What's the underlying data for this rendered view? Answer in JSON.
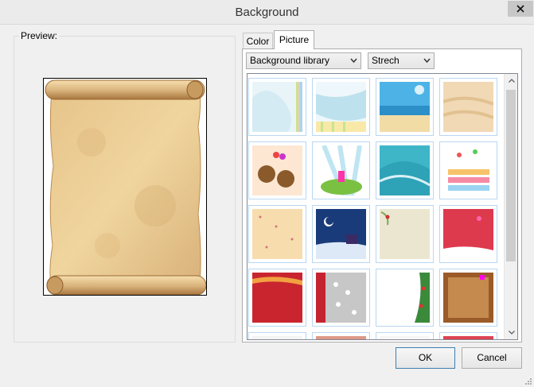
{
  "window": {
    "title": "Background",
    "close_icon": "close-icon"
  },
  "preview": {
    "legend": "Preview:"
  },
  "tabs": [
    {
      "label": "Color",
      "selected": false
    },
    {
      "label": "Picture",
      "selected": true
    }
  ],
  "controls": {
    "library_select": {
      "value": "Background library",
      "icon": "chevron-down-icon"
    },
    "stretch_select": {
      "value": "Strech",
      "icon": "chevron-down-icon"
    }
  },
  "buttons": {
    "ok": "OK",
    "cancel": "Cancel"
  },
  "colors": {
    "accent": "#3c7fb1",
    "title_bar": "#ebebeb",
    "close_button": "#c7c7c7",
    "thumb_border": "#b9d7f2"
  }
}
